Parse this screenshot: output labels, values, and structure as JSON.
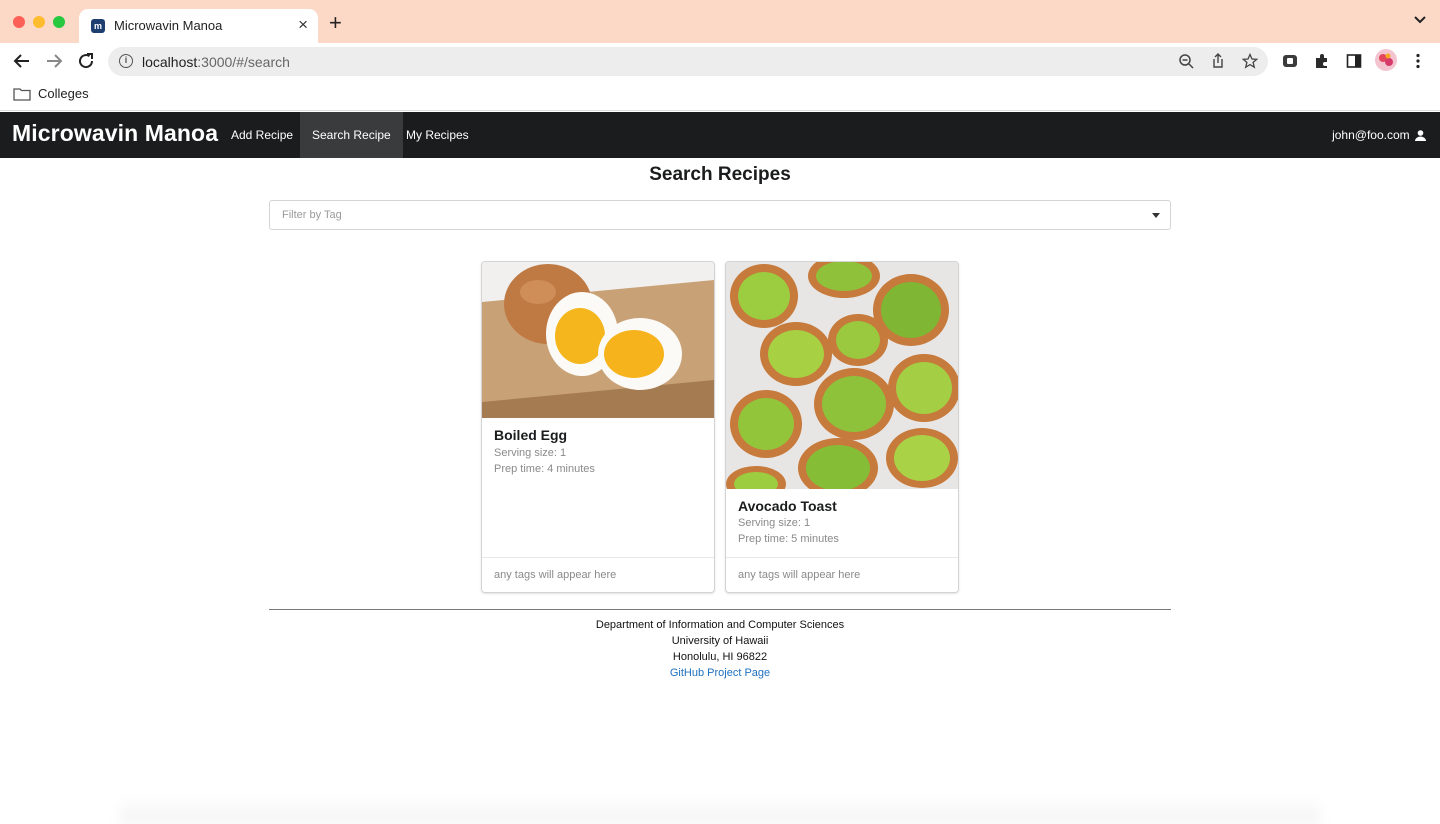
{
  "browser": {
    "tab_title": "Microwavin Manoa",
    "favicon_text": "m",
    "url_host": "localhost",
    "url_path": ":3000/#/search",
    "bookmark_folder": "Colleges"
  },
  "navbar": {
    "brand": "Microwavin Manoa",
    "items": [
      {
        "label": "Add Recipe",
        "active": false
      },
      {
        "label": "Search Recipe",
        "active": true
      },
      {
        "label": "My Recipes",
        "active": false
      }
    ],
    "user": "john@foo.com"
  },
  "search": {
    "title": "Search Recipes",
    "filter_placeholder": "Filter by Tag"
  },
  "recipes": [
    {
      "name": "Boiled Egg",
      "serving": "Serving size: 1",
      "prep": "Prep time: 4 minutes",
      "tags": "any tags will appear here",
      "image": "boiled-egg"
    },
    {
      "name": "Avocado Toast",
      "serving": "Serving size: 1",
      "prep": "Prep time: 5 minutes",
      "tags": "any tags will appear here",
      "image": "avocado-toast"
    }
  ],
  "footer": {
    "line1": "Department of Information and Computer Sciences",
    "line2": "University of Hawaii",
    "line3": "Honolulu, HI 96822",
    "link": "GitHub Project Page"
  },
  "colors": {
    "navbar_bg": "#1b1c1d",
    "tabstrip_bg": "#fcd9c7",
    "link": "#1e70bf"
  }
}
